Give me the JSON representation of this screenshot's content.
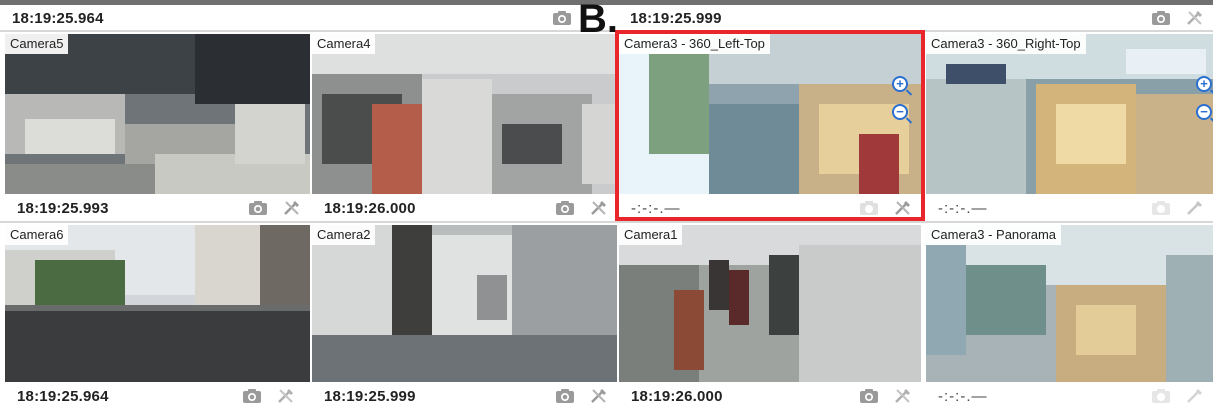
{
  "marker_label": "B.",
  "top_row": [
    {
      "timestamp": "18:19:25.964"
    },
    {
      "timestamp": "18:19:25.999"
    }
  ],
  "tiles": [
    {
      "label": "Camera5",
      "timestamp": "18:19:25.993"
    },
    {
      "label": "Camera4",
      "timestamp": "18:19:26.000"
    },
    {
      "label": "Camera3 - 360_Left-Top",
      "timestamp": "-:-:-.—"
    },
    {
      "label": "Camera3 - 360_Right-Top",
      "timestamp": "-:-:-.—"
    },
    {
      "label": "Camera6",
      "timestamp": "18:19:25.964"
    },
    {
      "label": "Camera2",
      "timestamp": "18:19:25.999"
    },
    {
      "label": "Camera1",
      "timestamp": "18:19:26.000"
    },
    {
      "label": "Camera3 - Panorama",
      "timestamp": "-:-:-.—"
    }
  ],
  "zoom_controls": {
    "zoom_in": "+",
    "zoom_out": "−"
  },
  "colors": {
    "highlight": "#e8262b",
    "zoom_accent": "#2a6fd0"
  }
}
